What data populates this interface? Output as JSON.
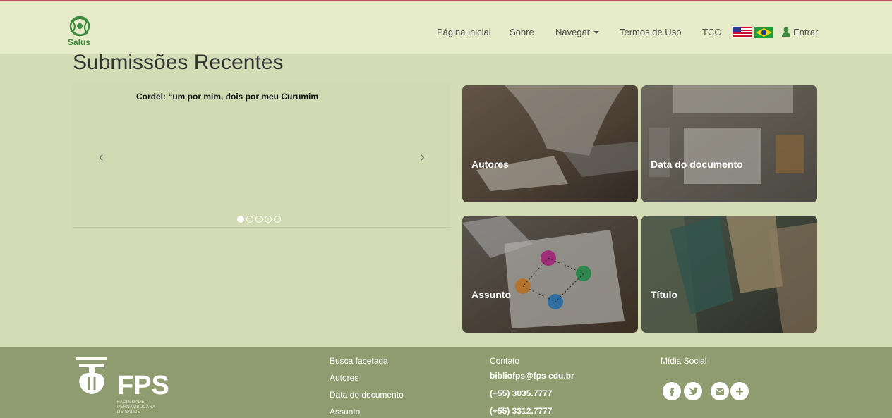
{
  "logo": {
    "text": "Salus"
  },
  "nav": {
    "home": "Página inicial",
    "about": "Sobre",
    "browse": "Navegar",
    "terms": "Termos de Uso",
    "tcc": "TCC",
    "login": "Entrar"
  },
  "main": {
    "title": "Submissões Recentes",
    "carousel": {
      "caption": "Cordel: “um por mim, dois por meu Curumim",
      "prev": "‹",
      "next": "›",
      "slide_count": 5,
      "active_slide": 1
    },
    "tiles": [
      {
        "label": "Autores"
      },
      {
        "label": "Data do documento"
      },
      {
        "label": "Assunto"
      },
      {
        "label": "Título"
      }
    ]
  },
  "footer": {
    "brand": "FPS",
    "brand_sub": [
      "FACULDADE",
      "PERNAMBUCANA",
      "DE SAÚDE"
    ],
    "links": [
      "Busca facetada",
      "Autores",
      "Data do documento",
      "Assunto"
    ],
    "contact_title": "Contato",
    "email": "bibliofps@fps edu.br",
    "phone1": "(+55) 3035.7777",
    "phone2": "(+55) 3312.7777",
    "social_title": "Mídia Social",
    "social_icons": [
      "facebook-icon",
      "twitter-icon",
      "email-icon",
      "plus-icon"
    ]
  },
  "colors": {
    "navbar": "#e6ecc9",
    "background": "#d4dcb6",
    "footer": "#8f9c6f",
    "logo_green": "#3c8a3c"
  }
}
